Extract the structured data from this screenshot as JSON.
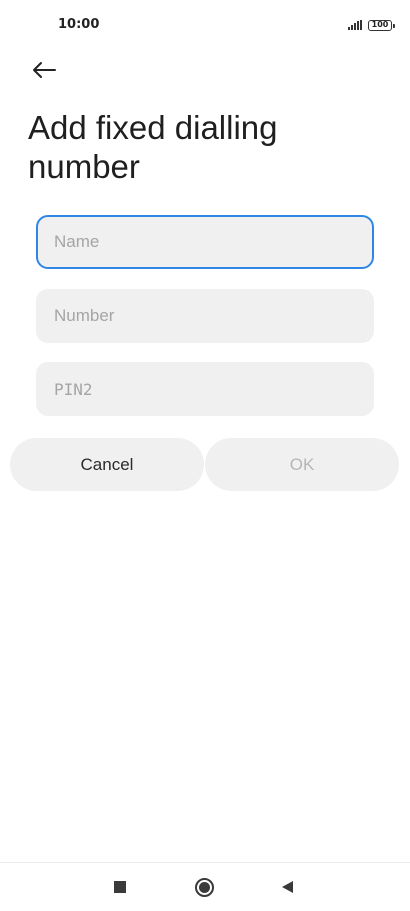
{
  "status_bar": {
    "time": "10:00",
    "battery": "100",
    "signal_icon": "signal-bars-icon",
    "battery_icon": "battery-icon"
  },
  "header": {
    "back_icon": "arrow-left-icon",
    "title": "Add fixed dialling number"
  },
  "form": {
    "name": {
      "placeholder": "Name",
      "value": ""
    },
    "number": {
      "placeholder": "Number",
      "value": ""
    },
    "pin2": {
      "placeholder": "PIN2",
      "value": ""
    }
  },
  "actions": {
    "cancel_label": "Cancel",
    "ok_label": "OK"
  },
  "nav_bar": {
    "recents_icon": "square-recents-icon",
    "home_icon": "circle-home-icon",
    "back_icon": "triangle-back-icon"
  },
  "colors": {
    "accent": "#2f86e6",
    "field_background": "#f0f0f0",
    "disabled_text": "#b6b6b6"
  }
}
